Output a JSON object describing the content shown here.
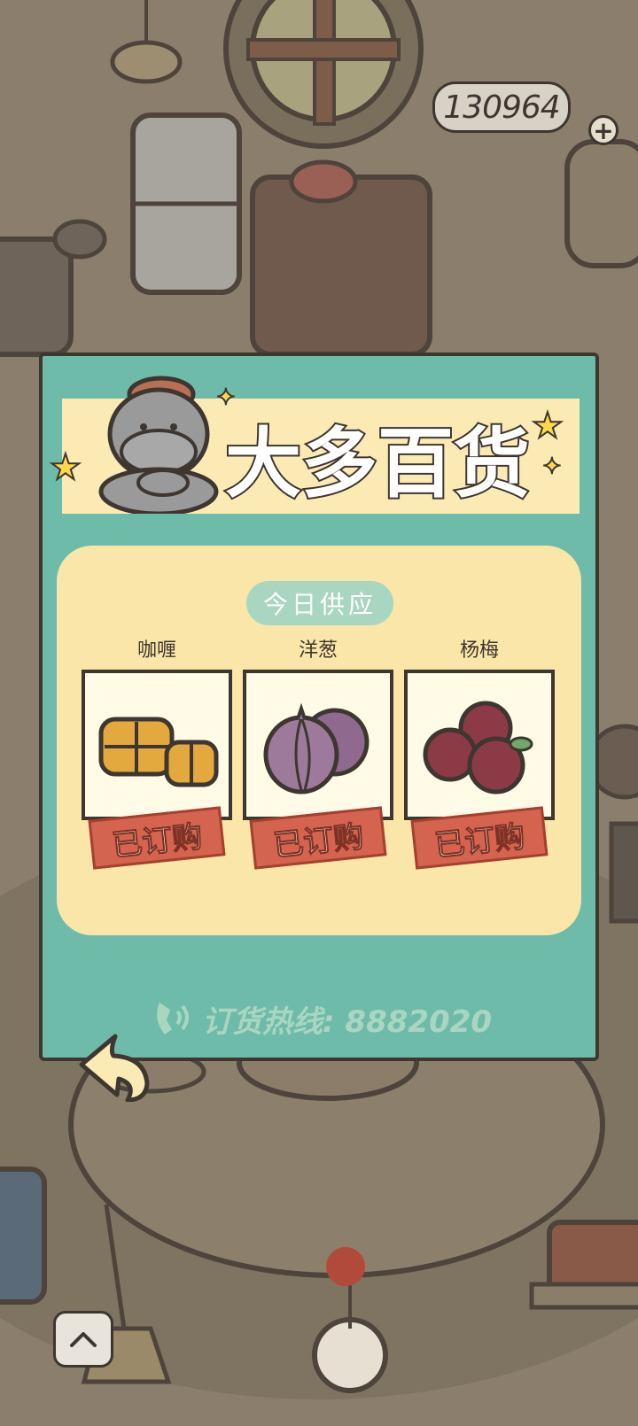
{
  "currency": {
    "amount": "130964",
    "add_icon": "plus-icon"
  },
  "shop": {
    "title": "大多百货",
    "section_label": "今日供应",
    "items": [
      {
        "name": "咖喱",
        "status": "已订购",
        "icon": "curry-icon"
      },
      {
        "name": "洋葱",
        "status": "已订购",
        "icon": "onion-icon"
      },
      {
        "name": "杨梅",
        "status": "已订购",
        "icon": "bayberry-icon"
      }
    ],
    "hotline": "订货热线: 8882020",
    "hotline_icon": "phone-icon"
  },
  "controls": {
    "back_icon": "back-arrow-icon",
    "expand_icon": "chevron-up-icon"
  },
  "colors": {
    "modal_bg": "#6ebba9",
    "banner_bg": "#fbeab4",
    "panel_bg": "#fbe6a9",
    "stamp_red": "#d4644f",
    "outline": "#3e3630"
  }
}
